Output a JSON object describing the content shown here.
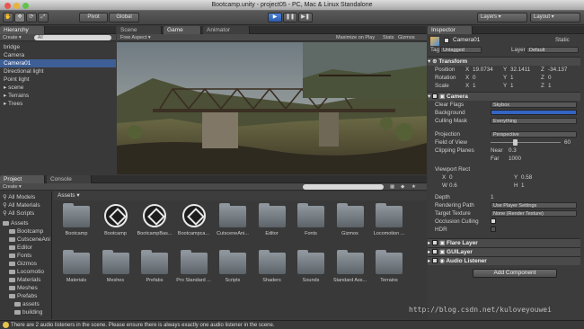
{
  "window": {
    "title": "Bootcamp.unity - project05 - PC, Mac & Linux Standalone"
  },
  "toolbar": {
    "pivot": "Pivot",
    "global": "Global",
    "layers": "Layers",
    "layout": "Layout"
  },
  "hierarchy": {
    "tab": "Hierarchy",
    "create": "Create",
    "search": "All",
    "items": [
      {
        "label": "bridge",
        "indent": 0,
        "selected": false
      },
      {
        "label": "Camera",
        "indent": 0,
        "selected": false
      },
      {
        "label": "Camera01",
        "indent": 0,
        "selected": true
      },
      {
        "label": "Directional light",
        "indent": 0,
        "selected": false
      },
      {
        "label": "Point light",
        "indent": 0,
        "selected": false
      },
      {
        "label": "▸ scene",
        "indent": 0,
        "selected": false
      },
      {
        "label": "▸ Terrains",
        "indent": 0,
        "selected": false
      },
      {
        "label": "▸ Trees",
        "indent": 0,
        "selected": false
      }
    ]
  },
  "scene": {
    "tabs": [
      "Scene",
      "Game",
      "Animator"
    ],
    "aspect": "Free Aspect",
    "options": [
      "Maximize on Play",
      "Stats",
      "Gizmos"
    ]
  },
  "project": {
    "tabs": [
      "Project",
      "Console"
    ],
    "create": "Create",
    "favorites": [
      "All Models",
      "All Materials",
      "All Scripts"
    ],
    "tree": [
      "Assets",
      "Bootcamp",
      "CutsceneAni",
      "Editor",
      "Fonts",
      "Gizmos",
      "Locomotio",
      "Materials",
      "Meshes",
      "Prefabs",
      "assets",
      "building"
    ],
    "breadcrumb": "Assets",
    "assets": [
      {
        "label": "Bootcamp",
        "kind": "folder"
      },
      {
        "label": "Bootcamp",
        "kind": "unity"
      },
      {
        "label": "BootcampBas...",
        "kind": "unity"
      },
      {
        "label": "Bootcampca...",
        "kind": "unity"
      },
      {
        "label": "CutsceneAni...",
        "kind": "folder"
      },
      {
        "label": "Editor",
        "kind": "folder"
      },
      {
        "label": "Fonts",
        "kind": "folder"
      },
      {
        "label": "Gizmos",
        "kind": "folder"
      },
      {
        "label": "Locomotion ...",
        "kind": "folder"
      },
      {
        "label": "Materials",
        "kind": "folder"
      },
      {
        "label": "Meshes",
        "kind": "folder"
      },
      {
        "label": "Prefabs",
        "kind": "folder"
      },
      {
        "label": "Pro Standard ...",
        "kind": "folder"
      },
      {
        "label": "Scripts",
        "kind": "folder"
      },
      {
        "label": "Shaders",
        "kind": "folder"
      },
      {
        "label": "Sounds",
        "kind": "folder"
      },
      {
        "label": "Standard Ass...",
        "kind": "folder"
      },
      {
        "label": "Terrains",
        "kind": "folder"
      }
    ]
  },
  "inspector": {
    "tab": "Inspector",
    "object": "Camera01",
    "static": "Static",
    "tag_label": "Tag",
    "tag": "Untagged",
    "layer_label": "Layer",
    "layer": "Default",
    "transform": {
      "title": "Transform",
      "rows": [
        {
          "k": "Position",
          "x": "19.0734",
          "y": "32.1411",
          "z": "-34.137"
        },
        {
          "k": "Rotation",
          "x": "0",
          "y": "1",
          "z": "0"
        },
        {
          "k": "Scale",
          "x": "1",
          "y": "1",
          "z": "1"
        }
      ]
    },
    "camera": {
      "title": "Camera",
      "clear_flags": "Skybox",
      "culling_mask": "Everything",
      "projection": "Perspective",
      "fov": "60",
      "near": "0.3",
      "far": "1000",
      "labels": {
        "clear_flags": "Clear Flags",
        "background": "Background",
        "culling_mask": "Culling Mask",
        "projection": "Projection",
        "fov": "Field of View",
        "clipping": "Clipping Planes",
        "near": "Near",
        "far": "Far",
        "viewport": "Viewport Rect",
        "depth": "Depth",
        "rendering_path": "Rendering Path",
        "target_texture": "Target Texture",
        "occlusion": "Occlusion Culling",
        "hdr": "HDR"
      },
      "viewport": {
        "x": "0",
        "y": "0.58",
        "w": "0.6",
        "h": "1"
      },
      "depth": "1",
      "rendering_path": "Use Player Settings",
      "target_texture": "None (Render Texture)"
    },
    "components": [
      "Flare Layer",
      "GUILayer",
      "Audio Listener"
    ],
    "add_component": "Add Component"
  },
  "status": {
    "message": "There are 2 audio listeners in the scene. Please ensure there is always exactly one audio listener in the scene.",
    "watermark": "http://blog.csdn.net/kuloveyouwei"
  }
}
